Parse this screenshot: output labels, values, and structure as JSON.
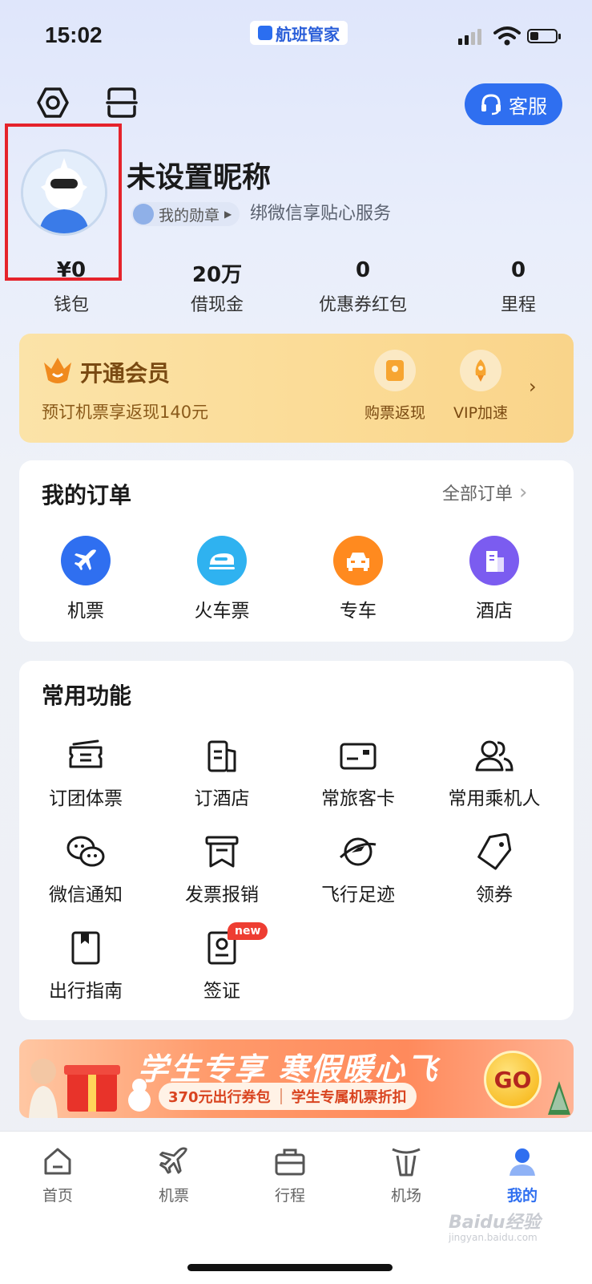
{
  "status_bar": {
    "time": "15:02",
    "app_badge": "航班管家"
  },
  "header": {
    "service_label": "客服"
  },
  "profile": {
    "nickname": "未设置昵称",
    "medal_label": "我的勋章",
    "wechat_hint": "绑微信享贴心服务"
  },
  "stats": [
    {
      "value": "¥0",
      "label": "钱包"
    },
    {
      "value": "20万",
      "label": "借现金"
    },
    {
      "value": "0",
      "label": "优惠券红包"
    },
    {
      "value": "0",
      "label": "里程"
    }
  ],
  "vip": {
    "title": "开通会员",
    "subtitle": "预订机票享返现140元",
    "perks": [
      "购票返现",
      "VIP加速"
    ]
  },
  "orders": {
    "title": "我的订单",
    "all_label": "全部订单",
    "items": [
      {
        "label": "机票",
        "color": "#2f6ff0",
        "icon": "plane-icon"
      },
      {
        "label": "火车票",
        "color": "#2fb2f0",
        "icon": "train-icon"
      },
      {
        "label": "专车",
        "color": "#ff8a1f",
        "icon": "car-icon"
      },
      {
        "label": "酒店",
        "color": "#7b5cf0",
        "icon": "hotel-icon"
      }
    ]
  },
  "functions": {
    "title": "常用功能",
    "items": [
      {
        "label": "订团体票",
        "icon": "group-ticket-icon"
      },
      {
        "label": "订酒店",
        "icon": "hotel-booking-icon"
      },
      {
        "label": "常旅客卡",
        "icon": "frequent-flyer-card-icon"
      },
      {
        "label": "常用乘机人",
        "icon": "passengers-icon"
      },
      {
        "label": "微信通知",
        "icon": "wechat-icon"
      },
      {
        "label": "发票报销",
        "icon": "invoice-icon"
      },
      {
        "label": "飞行足迹",
        "icon": "flight-footprint-icon"
      },
      {
        "label": "领券",
        "icon": "coupon-icon"
      },
      {
        "label": "出行指南",
        "icon": "guide-icon"
      },
      {
        "label": "签证",
        "icon": "visa-icon",
        "badge": "new"
      }
    ]
  },
  "promo": {
    "title": "学生专享 寒假暖心飞",
    "pill_left": "370元出行券包",
    "pill_right": "学生专属机票折扣",
    "go": "GO"
  },
  "tabs": [
    {
      "label": "首页",
      "icon": "home-icon",
      "active": false
    },
    {
      "label": "机票",
      "icon": "plane-icon",
      "active": false
    },
    {
      "label": "行程",
      "icon": "itinerary-icon",
      "active": false
    },
    {
      "label": "机场",
      "icon": "airport-icon",
      "active": false
    },
    {
      "label": "我的",
      "icon": "profile-icon",
      "active": true
    }
  ],
  "watermark": {
    "text": "Baidu经验",
    "sub": "jingyan.baidu.com"
  },
  "colors": {
    "accent": "#2f6ff0",
    "vip_gold": "#fbdb95",
    "highlight_box": "#e5232b"
  }
}
